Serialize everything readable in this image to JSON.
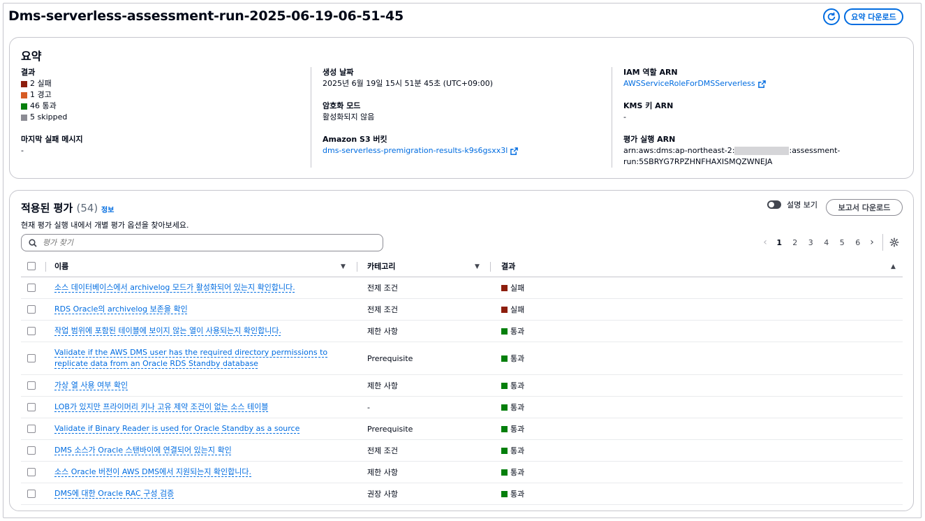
{
  "header": {
    "title": "Dms-serverless-assessment-run-2025-06-19-06-51-45",
    "download_summary_label": "요약 다운로드"
  },
  "summary": {
    "title": "요약",
    "results_label": "결과",
    "results": [
      {
        "text": "2 실패",
        "color": "#8d1e0d"
      },
      {
        "text": "1 경고",
        "color": "#d65b24"
      },
      {
        "text": "46 통과",
        "color": "#037f0c"
      },
      {
        "text": "5 skipped",
        "color": "#8c8c94"
      }
    ],
    "last_error_label": "마지막 실패 메시지",
    "last_error_value": "-",
    "created_label": "생성 날짜",
    "created_value": "2025년 6월 19일 15시 51분 45초 (UTC+09:00)",
    "encryption_label": "암호화 모드",
    "encryption_value": "활성화되지 않음",
    "s3_label": "Amazon S3 버킷",
    "s3_value": "dms-serverless-premigration-results-k9s6gsxx3l",
    "iam_label": "IAM 역할 ARN",
    "iam_value": "AWSServiceRoleForDMSServerless",
    "kms_label": "KMS 키 ARN",
    "kms_value": "-",
    "arn_label": "평가 실행 ARN",
    "arn_prefix": "arn:aws:dms:ap-northeast-2:",
    "arn_suffix": ":assessment-",
    "arn_line2": "run:5SBRYG7RPZHNFHAXISMQZWNEJA"
  },
  "assessments": {
    "title": "적용된 평가",
    "count": "(54)",
    "info_label": "정보",
    "description": "현재 평가 실행 내에서 개별 평가 옵션을 찾아보세요.",
    "toggle_label": "설명 보기",
    "report_button": "보고서 다운로드",
    "search_placeholder": "평가 찾기",
    "pages": [
      "1",
      "2",
      "3",
      "4",
      "5",
      "6"
    ],
    "columns": {
      "name": "이름",
      "category": "카테고리",
      "result": "결과"
    },
    "rows": [
      {
        "name": "소스 데이터베이스에서 archivelog 모드가 활성화되어 있는지 확인합니다.",
        "category": "전제 조건",
        "result": "실패",
        "color": "#8d1e0d"
      },
      {
        "name": "RDS Oracle의 archivelog 보존을 확인",
        "category": "전제 조건",
        "result": "실패",
        "color": "#8d1e0d"
      },
      {
        "name": "작업 범위에 포함된 테이블에 보이지 않는 열이 사용되는지 확인합니다.",
        "category": "제한 사항",
        "result": "통과",
        "color": "#037f0c"
      },
      {
        "name": "Validate if the AWS DMS user has the required directory permissions to replicate data from an Oracle RDS Standby database",
        "category": "Prerequisite",
        "result": "통과",
        "color": "#037f0c"
      },
      {
        "name": "가상 열 사용 여부 확인",
        "category": "제한 사항",
        "result": "통과",
        "color": "#037f0c"
      },
      {
        "name": "LOB가 있지만 프라이머리 키나 고유 제약 조건이 없는 소스 테이블",
        "category": "-",
        "result": "통과",
        "color": "#037f0c"
      },
      {
        "name": "Validate if Binary Reader is used for Oracle Standby as a source",
        "category": "Prerequisite",
        "result": "통과",
        "color": "#037f0c"
      },
      {
        "name": "DMS 소스가 Oracle 스탠바이에 연결되어 있는지 확인",
        "category": "전제 조건",
        "result": "통과",
        "color": "#037f0c"
      },
      {
        "name": "소스 Oracle 버전이 AWS DMS에서 지원되는지 확인합니다.",
        "category": "제한 사항",
        "result": "통과",
        "color": "#037f0c"
      },
      {
        "name": "DMS에 대한 Oracle RAC 구성 검증",
        "category": "권장 사항",
        "result": "통과",
        "color": "#037f0c"
      }
    ]
  }
}
